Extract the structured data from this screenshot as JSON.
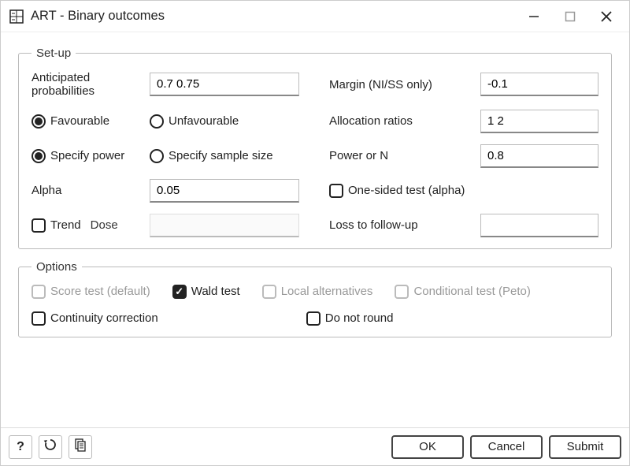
{
  "window": {
    "title": "ART - Binary outcomes"
  },
  "setup": {
    "legend": "Set-up",
    "anticipated_probabilities_label": "Anticipated probabilities",
    "anticipated_probabilities_value": "0.7 0.75",
    "favourable_label": "Favourable",
    "unfavourable_label": "Unfavourable",
    "specify_power_label": "Specify power",
    "specify_sample_size_label": "Specify sample size",
    "alpha_label": "Alpha",
    "alpha_value": "0.05",
    "trend_label": "Trend",
    "dose_label": "Dose",
    "dose_value": "",
    "margin_label": "Margin (NI/SS only)",
    "margin_value": "-0.1",
    "allocation_ratios_label": "Allocation ratios",
    "allocation_ratios_value": "1 2",
    "power_or_n_label": "Power or N",
    "power_or_n_value": "0.8",
    "one_sided_label": "One-sided test (alpha)",
    "loss_followup_label": "Loss to follow-up",
    "loss_followup_value": ""
  },
  "options": {
    "legend": "Options",
    "score_test_label": "Score test (default)",
    "wald_test_label": "Wald test",
    "local_alternatives_label": "Local alternatives",
    "conditional_test_label": "Conditional test (Peto)",
    "continuity_correction_label": "Continuity correction",
    "do_not_round_label": "Do not round"
  },
  "footer": {
    "help": "?",
    "ok": "OK",
    "cancel": "Cancel",
    "submit": "Submit"
  }
}
